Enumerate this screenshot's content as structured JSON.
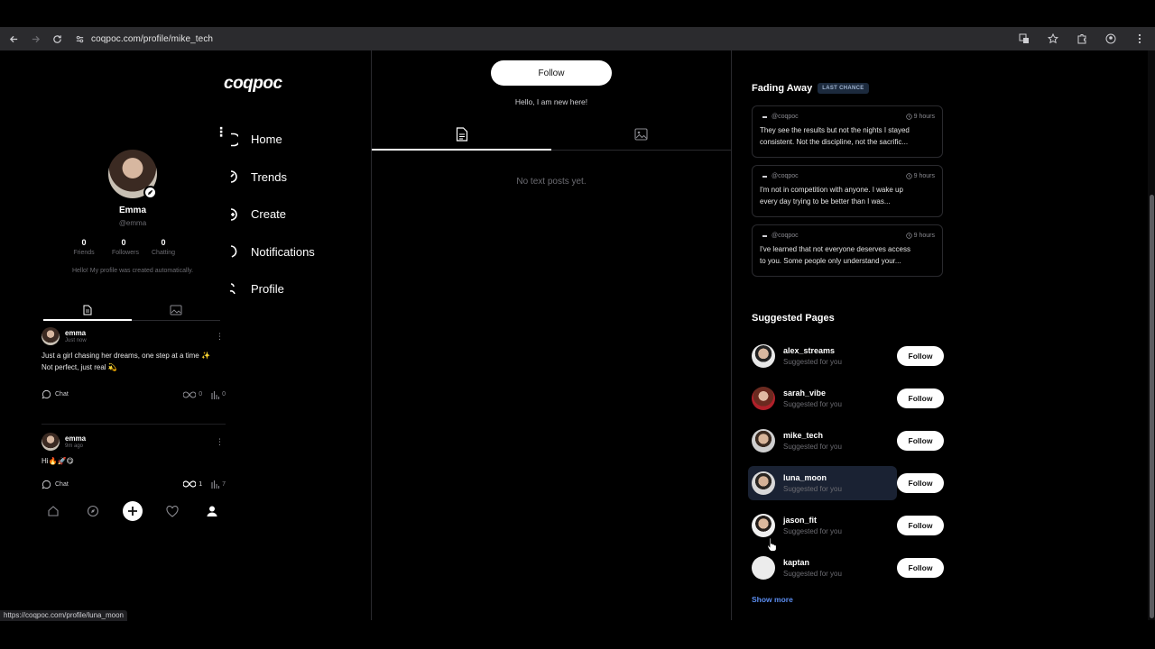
{
  "browser": {
    "url": "coqpoc.com/profile/mike_tech",
    "status_url": "https://coqpoc.com/profile/luna_moon"
  },
  "sidebar": {
    "logo": "coqpoc",
    "nav": [
      {
        "label": "Home",
        "icon": "home-icon"
      },
      {
        "label": "Trends",
        "icon": "trends-icon"
      },
      {
        "label": "Create",
        "icon": "create-icon"
      },
      {
        "label": "Notifications",
        "icon": "notifications-icon"
      },
      {
        "label": "Profile",
        "icon": "profile-icon"
      }
    ]
  },
  "profile": {
    "name": "Emma",
    "handle": "@emma",
    "stats": [
      {
        "value": "0",
        "label": "Friends"
      },
      {
        "value": "0",
        "label": "Followers"
      },
      {
        "value": "0",
        "label": "Chatting"
      }
    ],
    "bio": "Hello! My profile was created automatically."
  },
  "posts": [
    {
      "user": "emma",
      "time": "Just now",
      "text_line1": "Just a girl chasing her dreams, one step at a time ✨",
      "text_line2": "Not perfect, just real 💫",
      "chat": "Chat",
      "loops": "0",
      "views": "0"
    },
    {
      "user": "emma",
      "time": "9m ago",
      "text_line1": "Hi🔥🚀😋",
      "text_line2": "",
      "chat": "Chat",
      "loops": "1",
      "views": "7"
    }
  ],
  "main": {
    "follow_label": "Follow",
    "bio": "Hello, I am new here!",
    "empty": "No text posts yet."
  },
  "fading": {
    "title": "Fading Away",
    "badge": "LAST CHANCE",
    "items": [
      {
        "handle": "@coqpoc",
        "time": "9 hours",
        "line1": "They see the results but not the nights I stayed",
        "line2": "consistent. Not the discipline, not the sacrific..."
      },
      {
        "handle": "@coqpoc",
        "time": "9 hours",
        "line1": "I'm not in competition with anyone. I wake up",
        "line2": "every day trying to be better than I was..."
      },
      {
        "handle": "@coqpoc",
        "time": "9 hours",
        "line1": "I've learned that not everyone deserves access",
        "line2": "to you. Some people only understand your..."
      }
    ]
  },
  "suggested": {
    "title": "Suggested Pages",
    "items": [
      {
        "name": "alex_streams",
        "sub": "Suggested for you",
        "follow": "Follow"
      },
      {
        "name": "sarah_vibe",
        "sub": "Suggested for you",
        "follow": "Follow"
      },
      {
        "name": "mike_tech",
        "sub": "Suggested for you",
        "follow": "Follow"
      },
      {
        "name": "luna_moon",
        "sub": "Suggested for you",
        "follow": "Follow"
      },
      {
        "name": "jason_fit",
        "sub": "Suggested for you",
        "follow": "Follow"
      },
      {
        "name": "kaptan",
        "sub": "Suggested for you",
        "follow": "Follow"
      }
    ],
    "show_more": "Show more"
  }
}
